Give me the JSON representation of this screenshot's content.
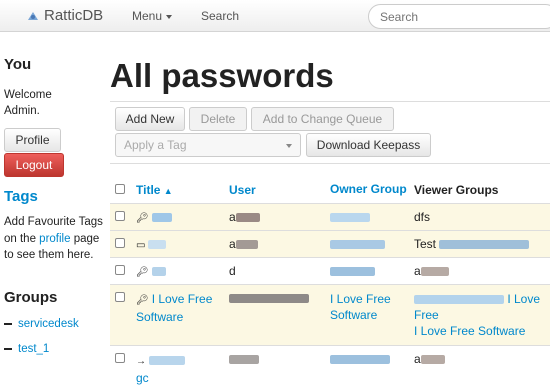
{
  "navbar": {
    "brand": "RatticDB",
    "menu_label": "Menu",
    "search_link": "Search",
    "search_placeholder": "Search"
  },
  "sidebar": {
    "you_title": "You",
    "welcome_text": "Welcome Admin.",
    "profile_button": "Profile",
    "logout_button": "Logout",
    "tags_title": "Tags",
    "tags_text_before": "Add Favourite Tags on the ",
    "tags_link": "profile",
    "tags_text_after": " page to see them here.",
    "groups_title": "Groups",
    "groups": [
      "servicedesk",
      "test_1"
    ]
  },
  "main": {
    "title": "All passwords",
    "buttons": {
      "add_new": "Add New",
      "delete": "Delete",
      "add_to_queue": "Add to Change Queue",
      "download": "Download Keepass",
      "apply_tag": "Apply a Tag"
    },
    "columns": {
      "title": "Title",
      "user": "User",
      "owner_group": "Owner Group",
      "viewer_groups": "Viewer Groups"
    },
    "rows": [
      {
        "title": "",
        "user": "a",
        "owner": "",
        "viewer": "dfs"
      },
      {
        "title": "",
        "user": "a",
        "owner": "",
        "viewer": "Test"
      },
      {
        "title": "",
        "user": "d",
        "owner": "",
        "viewer": "a"
      },
      {
        "title": "I Love Free Software",
        "user": "",
        "owner": "Software",
        "viewer": "I Love Free Software"
      },
      {
        "title": "gc",
        "user": "",
        "owner": "",
        "viewer": "a"
      }
    ],
    "row4_owner_prefix": "I Love Free",
    "row4_viewer_suffix": "I Love Free"
  }
}
